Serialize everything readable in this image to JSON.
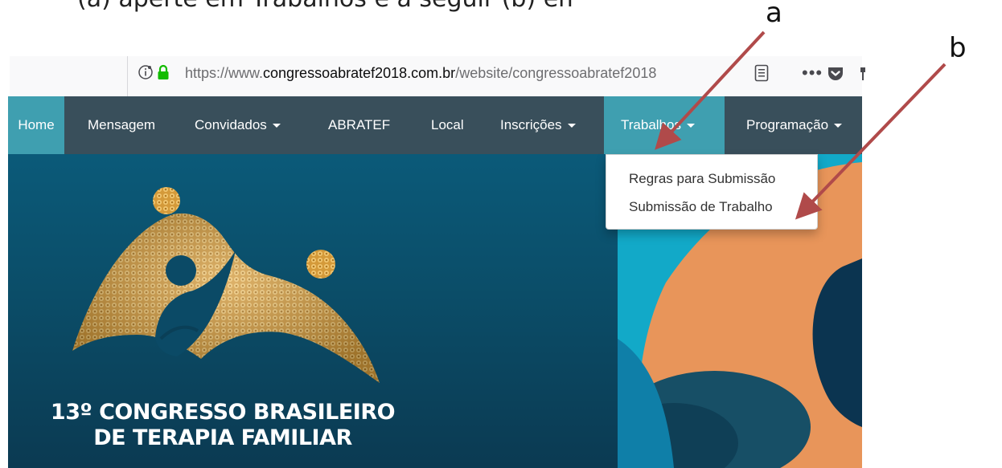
{
  "caption": {
    "text": "(a) aperte em Trabalhos e a seguir (b) em Submissão de Trabalho"
  },
  "browser": {
    "url_prefix": "https://www.",
    "url_domain": "congressoabratef2018.com.br",
    "url_path": "/website/congressoabratef2018",
    "more_label": "•••"
  },
  "navbar": {
    "items": [
      {
        "label": "Home",
        "has_caret": false
      },
      {
        "label": "Mensagem",
        "has_caret": false
      },
      {
        "label": "Convidados",
        "has_caret": true
      },
      {
        "label": "ABRATEF",
        "has_caret": false
      },
      {
        "label": "Local",
        "has_caret": false
      },
      {
        "label": "Inscrições",
        "has_caret": true
      },
      {
        "label": "Trabalhos",
        "has_caret": true,
        "active": true
      },
      {
        "label": "Programação",
        "has_caret": true
      }
    ]
  },
  "dropdown": {
    "items": [
      "Regras para Submissão",
      "Submissão de Trabalho"
    ]
  },
  "hero": {
    "line1": "13º CONGRESSO BRASILEIRO",
    "line2": "DE TERAPIA FAMILIAR"
  },
  "annotations": {
    "a": "a",
    "b": "b"
  },
  "colors": {
    "navbar": "#394f5b",
    "navbar_active": "#3f9fb0",
    "hero_blue": "#0b4d68",
    "gold": "#d9a441",
    "arrow": "#b04a4a",
    "banner_cyan": "#11c3d6",
    "banner_orange": "#e8955a"
  }
}
